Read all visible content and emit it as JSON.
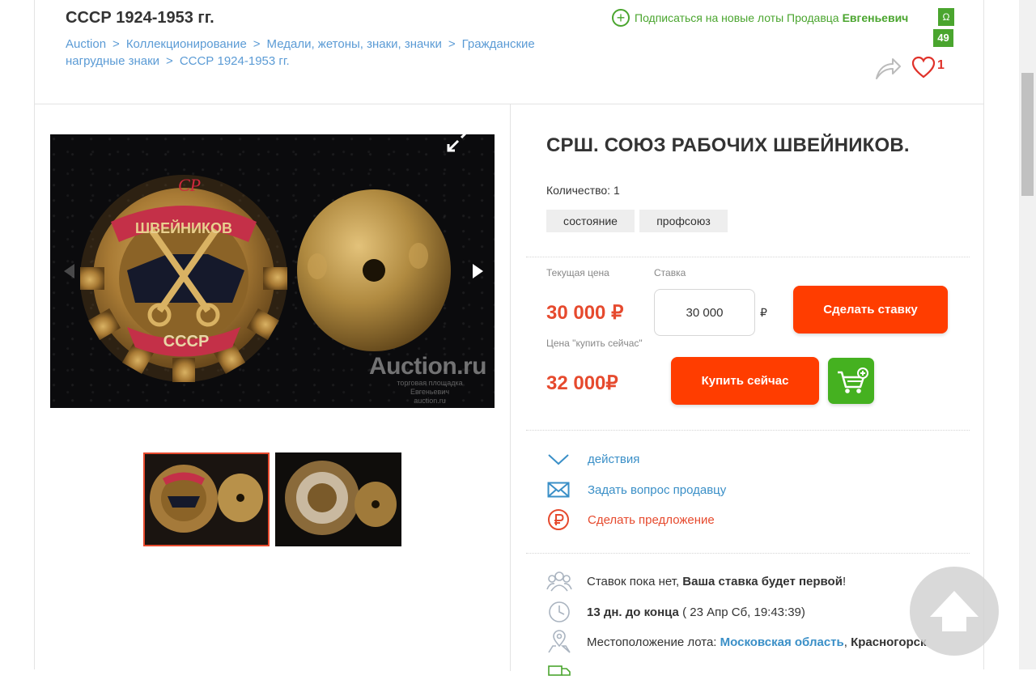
{
  "header": {
    "category_title": "СССР 1924-1953 гг.",
    "breadcrumb": [
      "Auction",
      "Коллекционирование",
      "Медали, жетоны, знаки, значки",
      "Гражданские нагрудные знаки",
      "СССР 1924-1953 гг."
    ],
    "breadcrumb_separator": ">",
    "subscribe_text": "Подписаться на новые лоты Продавца",
    "seller_name": "Евгеньевич",
    "seller_badge": "Ω",
    "seller_rating": "49",
    "favorites_count": "1"
  },
  "gallery": {
    "watermark": "Auction.ru",
    "watermark_sub": "торговая площадка Евгеньевич auction.ru",
    "badge_ribbon_text": "ШВЕЙНИКОВ",
    "badge_top_text": "СР",
    "badge_bottom_text": "СССР",
    "thumbnails": [
      "фото 1",
      "фото 2"
    ]
  },
  "lot": {
    "title": "СРШ. СОЮЗ РАБОЧИХ ШВЕЙНИКОВ.",
    "quantity_label": "Количество:",
    "quantity_value": "1",
    "tags": [
      "состояние",
      "профсоюз"
    ]
  },
  "pricing": {
    "current_price_label": "Текущая цена",
    "current_price": "30 000 ₽",
    "bid_label": "Ставка",
    "bid_value": "30 000",
    "currency": "₽",
    "bid_button": "Сделать ставку",
    "buy_now_label": "Цена \"купить сейчас\"",
    "buy_now_price": "32 000₽",
    "buy_now_button": "Купить сейчас"
  },
  "actions": {
    "actions_link": "действия",
    "ask_seller": "Задать вопрос продавцу",
    "make_offer": "Сделать предложение"
  },
  "info": {
    "bids_prefix": "Ставок пока нет,",
    "bids_bold": "Ваша ставка будет первой",
    "bids_suffix": "!",
    "time_bold": "13 дн. до конца",
    "time_detail": "( 23 Апр Сб, 19:43:39)",
    "location_label": "Местоположение лота:",
    "location_region": "Московская область",
    "location_city": "Красногорск"
  },
  "colors": {
    "accent_orange": "#ff3d00",
    "price_red": "#e64a2e",
    "link_blue": "#3a8fc7",
    "green": "#4aa52e"
  }
}
